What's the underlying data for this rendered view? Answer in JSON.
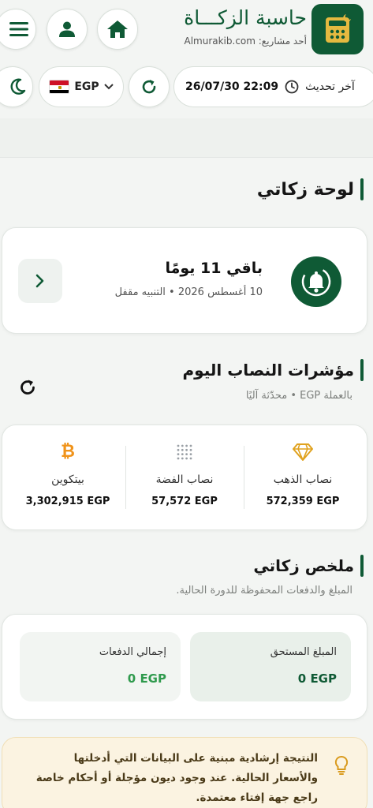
{
  "header": {
    "app_title": "حاسبة الزكـــاة",
    "app_subtitle": "أحد مشاريع: Almurakib.com",
    "logo_icon": "calculator-icon",
    "home_icon": "home-icon",
    "user_icon": "user-icon",
    "menu_icon": "menu-icon"
  },
  "toolbar": {
    "last_update_label": "آخر تحديث",
    "last_update_value": "26/07/30 22:09",
    "currency": "EGP",
    "flag": "egypt-flag-icon"
  },
  "dashboard": {
    "title": "لوحة زكاتي",
    "reminder_title": "باقي 11 يومًا",
    "reminder_sub": "10 أغسطس 2026 • التنبيه مقفل"
  },
  "nisab": {
    "title": "مؤشرات النصاب اليوم",
    "subtitle": "بالعملة EGP • محدّثة آليًا",
    "items": [
      {
        "label": "نصاب الذهب",
        "value": "572,359 EGP",
        "icon": "gem-icon",
        "color": "#e0a21f"
      },
      {
        "label": "نصاب الفضة",
        "value": "57,572 EGP",
        "icon": "dots-grid-icon",
        "color": "#9aa0a6"
      },
      {
        "label": "بيتكوين",
        "value": "3,302,915 EGP",
        "icon": "bitcoin-icon",
        "color": "#f0931a"
      }
    ]
  },
  "summary": {
    "title": "ملخص زكاتي",
    "subtitle": "المبلغ والدفعات المحفوظة للدورة الحالية.",
    "due_label": "المبلغ المستحق",
    "due_value": "0 EGP",
    "payments_label": "إجمالي الدفعات",
    "payments_value": "0 EGP"
  },
  "notice": {
    "line1": "النتيجة إرشادية مبنية على البيانات التي أدخلتها",
    "line2": "والأسعار الحالية. عند وجود ديون مؤجلة أو أحكام خاصة",
    "line3": "راجع جهة إفتاء معتمدة."
  },
  "colors": {
    "brand": "#0f5a35",
    "accent_green": "#2f9a4d",
    "notice_bg": "#fbf3e1"
  }
}
